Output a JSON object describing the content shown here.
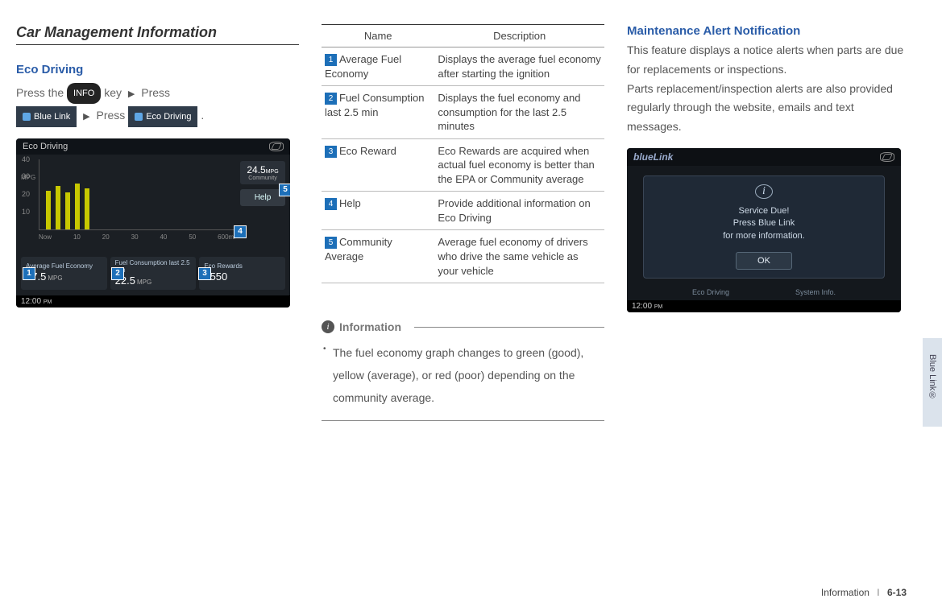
{
  "col1": {
    "section_title": "Car Management Information",
    "sub_title": "Eco Driving",
    "press_the": "Press the",
    "info_key": "INFO",
    "key_word": "key",
    "press_word": "Press",
    "blue_link_btn": "Blue Link",
    "eco_driving_btn": "Eco Driving",
    "period": "."
  },
  "eco_shot": {
    "title": "Eco Driving",
    "chart_ylabel": "MPG",
    "side_mpg": "24.5",
    "side_mpg_unit": "MPG",
    "side_sub": "Community",
    "help": "Help",
    "stat1_label": "Average Fuel Economy",
    "stat1_val": "27.5",
    "stat1_unit": "MPG",
    "stat2_label": "Fuel Consumption last 2.5 min",
    "stat2_val": "22.5",
    "stat2_unit": "MPG",
    "stat3_label": "Eco Rewards",
    "stat3_val": "3550",
    "clock": "12:00",
    "clock_ampm": "PM"
  },
  "chart_data": {
    "type": "bar",
    "ylabel": "MPG",
    "yticks": [
      10,
      20,
      30,
      40
    ],
    "ylim": [
      0,
      40
    ],
    "xlabels": [
      "Now",
      "10",
      "20",
      "30",
      "40",
      "50",
      "600ml"
    ],
    "values": [
      22,
      25,
      21,
      26,
      23
    ],
    "bar_color": "#c7c700",
    "side_panel": {
      "community_avg_mpg": 24.5
    },
    "bottom_stats": {
      "average_fuel_economy_mpg": 27.5,
      "fuel_consumption_last_2_5_min_mpg": 22.5,
      "eco_rewards": 3550
    }
  },
  "callouts": {
    "c1": "1",
    "c2": "2",
    "c3": "3",
    "c4": "4",
    "c5": "5"
  },
  "table": {
    "head_name": "Name",
    "head_desc": "Description",
    "rows": [
      {
        "n": "1",
        "name": "Average Fuel Economy",
        "desc": "Displays the average fuel economy after starting the ignition"
      },
      {
        "n": "2",
        "name": "Fuel Consumption last 2.5 min",
        "desc": "Displays the fuel economy and consumption for the last 2.5 minutes"
      },
      {
        "n": "3",
        "name": "Eco Reward",
        "desc": "Eco Rewards are acquired when actual fuel economy is better than the EPA or Community average"
      },
      {
        "n": "4",
        "name": "Help",
        "desc": "Provide additional information on Eco Driving"
      },
      {
        "n": "5",
        "name": "Community Average",
        "desc": "Average fuel economy of drivers who drive the same vehicle as your vehicle"
      }
    ]
  },
  "info_block": {
    "title": "Information",
    "body": "The fuel economy graph changes to green (good), yellow (average), or red (poor) depending on the community average."
  },
  "col3": {
    "title": "Maintenance Alert Notification",
    "p1": "This feature displays a notice alerts when parts are due for replacements or inspections.",
    "p2": "Parts replacement/inspection alerts are also provided regularly through the website, emails and text messages."
  },
  "maint_shot": {
    "logo": "blueLink",
    "msg_line1": "Service Due!",
    "msg_line2": "Press Blue Link",
    "msg_line3": "for more information.",
    "ok": "OK",
    "tab1": "Eco Driving",
    "tab2": "System Info.",
    "clock": "12:00",
    "clock_ampm": "PM"
  },
  "side_tab": "Blue Link®",
  "footer": {
    "label": "Information",
    "page": "6-13"
  }
}
